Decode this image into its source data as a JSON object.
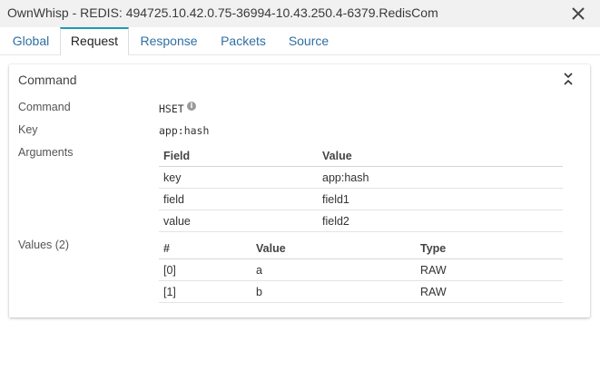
{
  "window": {
    "title": "OwnWhisp - REDIS: 494725.10.42.0.75-36994-10.43.250.4-6379.RedisCom"
  },
  "tabs": [
    {
      "label": "Global"
    },
    {
      "label": "Request"
    },
    {
      "label": "Response"
    },
    {
      "label": "Packets"
    },
    {
      "label": "Source"
    }
  ],
  "active_tab": "Request",
  "panel": {
    "title": "Command",
    "command_label": "Command",
    "command_value": "HSET",
    "key_label": "Key",
    "key_value": "app:hash",
    "arguments_label": "Arguments",
    "arguments": {
      "headers": [
        "Field",
        "Value"
      ],
      "rows": [
        [
          "key",
          "app:hash"
        ],
        [
          "field",
          "field1"
        ],
        [
          "value",
          "field2"
        ]
      ]
    },
    "values_label": "Values (2)",
    "values": {
      "headers": [
        "#",
        "Value",
        "Type"
      ],
      "rows": [
        [
          "[0]",
          "a",
          "RAW"
        ],
        [
          "[1]",
          "b",
          "RAW"
        ]
      ]
    }
  },
  "icons": {
    "close": "close-icon",
    "collapse": "collapse-chevrons-icon",
    "info": "info-icon"
  },
  "colors": {
    "active_tab_accent": "#1f9ab8",
    "tab_link": "#2f6fa3"
  }
}
